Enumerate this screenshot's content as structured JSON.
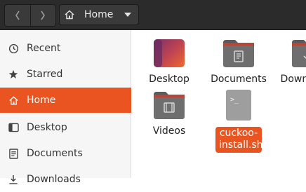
{
  "header": {
    "back_icon": "chevron-left-icon",
    "forward_icon": "chevron-right-icon",
    "path_icon": "home-icon",
    "path_label": "Home",
    "dropdown_icon": "triangle-down-icon"
  },
  "sidebar": {
    "items": [
      {
        "label": "Recent",
        "icon": "clock-icon"
      },
      {
        "label": "Starred",
        "icon": "star-icon"
      },
      {
        "label": "Home",
        "icon": "home-icon",
        "active": true
      },
      {
        "label": "Desktop",
        "icon": "desktop-icon"
      },
      {
        "label": "Documents",
        "icon": "document-icon"
      },
      {
        "label": "Downloads",
        "icon": "download-icon"
      }
    ]
  },
  "files": [
    {
      "label": "Desktop",
      "icon": "desktop-folder-icon"
    },
    {
      "label": "Documents",
      "icon": "documents-folder-icon"
    },
    {
      "label": "Downloads",
      "icon": "downloads-folder-icon"
    },
    {
      "label": "Videos",
      "icon": "videos-folder-icon"
    },
    {
      "label": "cuckoo-install.sh",
      "icon": "script-file-icon",
      "selected": true
    }
  ],
  "colors": {
    "accent": "#e95420",
    "header": "#2b2b2b",
    "folder": "#6e6e6e"
  }
}
